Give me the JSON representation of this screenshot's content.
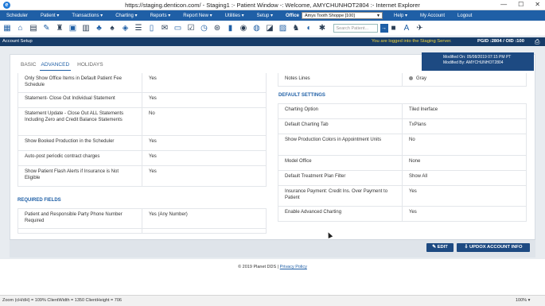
{
  "window": {
    "title": "https://staging.denticon.com/ - Staging1 :- Patient Window -: Welcome, AMYCHUNHOT2804 :- Internet Explorer",
    "controls": [
      "—",
      "☐",
      "✕"
    ]
  },
  "menubar": {
    "items": [
      "Scheduler",
      "Patient ▾",
      "Transactions ▾",
      "Charting ▾",
      "Reports ▾",
      "Report New ▾",
      "Utilities ▾",
      "Setup ▾"
    ],
    "office_label": "Office",
    "office_value": "Amys Tooth Shoppe [100]",
    "right_items": [
      "Help ▾",
      "My Account",
      "Logout"
    ]
  },
  "toolbar": {
    "search_placeholder": "Search Patient...",
    "icons": [
      "calendar-icon",
      "home-icon",
      "grid-icon",
      "edit-icon",
      "tooth-icon",
      "doc-icon",
      "calc-icon",
      "people-icon",
      "group-icon",
      "tooth-chart-icon",
      "list-icon",
      "page-icon",
      "mail-icon",
      "chat-icon",
      "check-doc-icon",
      "clock-icon",
      "alert-icon",
      "book-icon",
      "eye-icon",
      "globe-icon",
      "message-icon",
      "image-icon",
      "users-icon",
      "dashboard-icon",
      "settings-icon"
    ]
  },
  "header": {
    "page_name": "Account Setup",
    "staging_notice": "You are logged into the Staging Server.",
    "pgid": "PGID :2804 / OID :100"
  },
  "tabs": [
    "BASIC",
    "ADVANCED",
    "HOLIDAYS"
  ],
  "modified": {
    "on": "Modified On: 05/08/2019 07:15 PM PT",
    "by": "Modified By: AMYCHUNHOT2804"
  },
  "left_rows": [
    {
      "label": "Only Show Office Items in Default Patient Fee Schedule",
      "value": "Yes"
    },
    {
      "label": "Statement- Close Out Individual Statement",
      "value": "Yes"
    },
    {
      "label": "Statement Update - Close Out ALL Statements Including Zero and Credit Balance Statements",
      "value": "No"
    },
    {
      "label": "Show Booked Production in the Scheduler",
      "value": "Yes"
    },
    {
      "label": "Auto-post periodic contract charges",
      "value": "Yes"
    },
    {
      "label": "Show Patient Flash Alerts if Insurance is Not Eligible",
      "value": "Yes"
    }
  ],
  "required_fields": {
    "title": "REQUIRED FIELDS",
    "rows": [
      {
        "label": "Patient and Responsible Party Phone Number Required",
        "value": "Yes (Any Number)"
      }
    ]
  },
  "notes_lines": {
    "label": "Notes Lines",
    "value": "Gray",
    "color": "#8d8d8d"
  },
  "default_settings": {
    "title": "DEFAULT SETTINGS",
    "rows": [
      {
        "label": "Charting Option",
        "value": "Tiled Inerface"
      },
      {
        "label": "Default Charting Tab",
        "value": "TxPlans"
      },
      {
        "label": "Show Production Colors in Appointment Units",
        "value": "No"
      },
      {
        "label": "Model Office",
        "value": "None"
      },
      {
        "label": "Default Treatment Plan Filter",
        "value": "Show All"
      },
      {
        "label": "Insurance Payment: Credit Ins. Over Payment to Patient",
        "value": "Yes"
      },
      {
        "label": "Enable Advanced Charting",
        "value": "Yes"
      }
    ]
  },
  "buttons": {
    "edit": "✎ EDIT",
    "updox": "⇩ UPDOX ACCOUNT INFO"
  },
  "footer": {
    "copyright": "© 2019 Planet DDS |",
    "privacy": "Privacy Policy"
  },
  "statusbar": {
    "info": "Zoom (cH/dH) = 109%   ClientWidth = 1350  ClientHeight = 706",
    "zoom": "100% ▾"
  }
}
